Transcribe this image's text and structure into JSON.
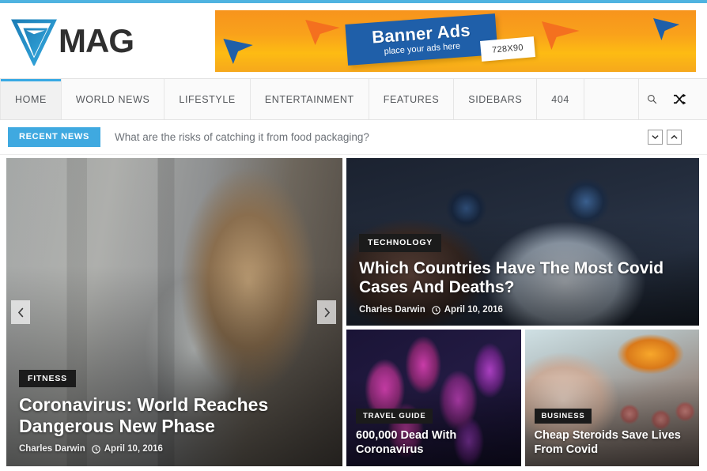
{
  "site": {
    "logo_text": "MAG",
    "accent_color": "#4fb3e0"
  },
  "banner": {
    "title": "Banner Ads",
    "subtitle": "place your ads here",
    "size_label": "728X90"
  },
  "nav": {
    "items": [
      {
        "label": "HOME",
        "active": true
      },
      {
        "label": "WORLD NEWS",
        "active": false
      },
      {
        "label": "LIFESTYLE",
        "active": false
      },
      {
        "label": "ENTERTAINMENT",
        "active": false
      },
      {
        "label": "FEATURES",
        "active": false
      },
      {
        "label": "SIDEBARS",
        "active": false
      },
      {
        "label": "404",
        "active": false
      }
    ],
    "tools": [
      {
        "name": "search-icon"
      },
      {
        "name": "shuffle-icon"
      }
    ]
  },
  "recent_news": {
    "tag": "RECENT NEWS",
    "headline": "What are the risks of catching it from food packaging?",
    "prev_icon": "chevron-down-icon",
    "next_icon": "chevron-up-icon"
  },
  "slider": {
    "prev_icon": "chevron-left-icon",
    "next_icon": "chevron-right-icon"
  },
  "featured": {
    "main": {
      "category": "FITNESS",
      "title": "Coronavirus: World Reaches Dangerous New Phase",
      "author": "Charles Darwin",
      "date": "April 10, 2016"
    },
    "top_right": {
      "category": "TECHNOLOGY",
      "title": "Which Countries Have The Most Covid Cases And Deaths?",
      "author": "Charles Darwin",
      "date": "April 10, 2016"
    },
    "bottom_left": {
      "category": "TRAVEL GUIDE",
      "title": "600,000 Dead With Coronavirus"
    },
    "bottom_right": {
      "category": "BUSINESS",
      "title": "Cheap Steroids Save Lives From Covid"
    }
  }
}
